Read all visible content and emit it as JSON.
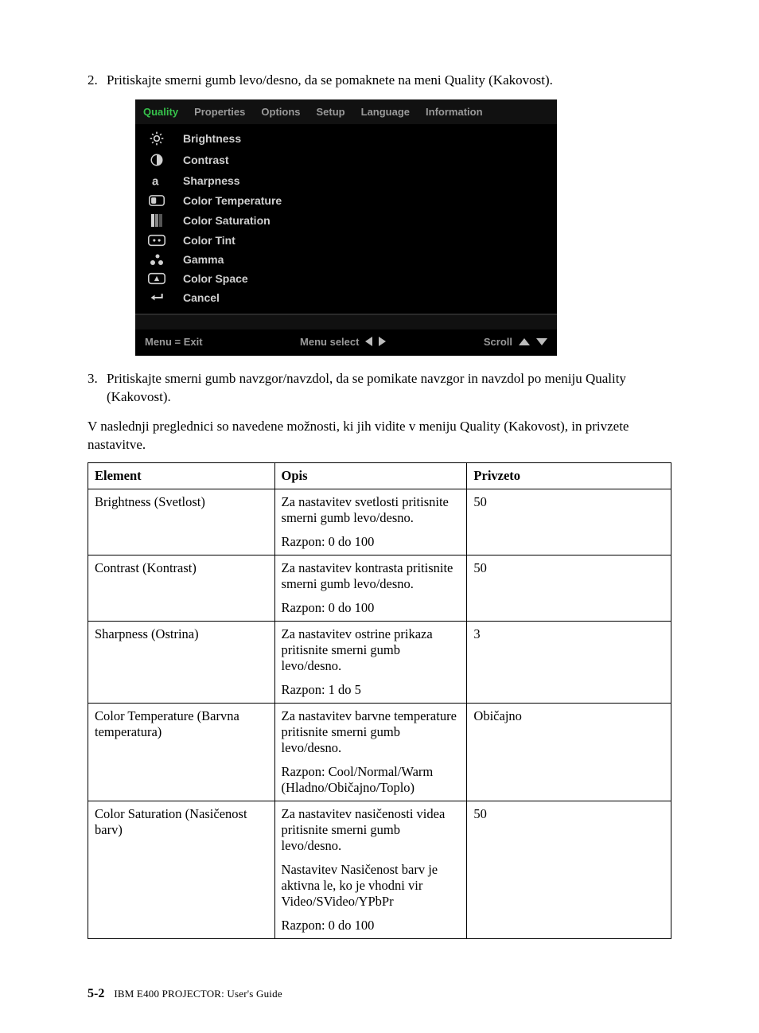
{
  "steps": {
    "s2": {
      "num": "2.",
      "text": "Pritiskajte smerni gumb levo/desno, da se pomaknete na meni Quality (Kakovost)."
    },
    "s3": {
      "num": "3.",
      "text": "Pritiskajte smerni gumb navzgor/navzdol, da se pomikate navzgor in navzdol po meniju Quality (Kakovost)."
    }
  },
  "osd": {
    "tabs": {
      "quality": "Quality",
      "properties": "Properties",
      "options": "Options",
      "setup": "Setup",
      "language": "Language",
      "information": "Information"
    },
    "items": {
      "brightness": "Brightness",
      "contrast": "Contrast",
      "sharpness": "Sharpness",
      "color_temperature": "Color Temperature",
      "color_saturation": "Color Saturation",
      "color_tint": "Color Tint",
      "gamma": "Gamma",
      "color_space": "Color Space",
      "cancel": "Cancel"
    },
    "footer": {
      "menu_exit": "Menu = Exit",
      "menu_select": "Menu select",
      "scroll": "Scroll"
    }
  },
  "intro_para": "V naslednji preglednici so navedene možnosti, ki jih vidite v meniju Quality (Kakovost), in privzete nastavitve.",
  "table": {
    "headers": {
      "element": "Element",
      "opis": "Opis",
      "privzeto": "Privzeto"
    },
    "rows": [
      {
        "element": "Brightness (Svetlost)",
        "opis1": "Za nastavitev svetlosti pritisnite smerni gumb levo/desno.",
        "opis2": "Razpon: 0 do 100",
        "privzeto": "50"
      },
      {
        "element": "Contrast (Kontrast)",
        "opis1": "Za nastavitev kontrasta pritisnite smerni gumb levo/desno.",
        "opis2": "Razpon: 0 do 100",
        "privzeto": "50"
      },
      {
        "element": "Sharpness (Ostrina)",
        "opis1": "Za nastavitev ostrine prikaza pritisnite smerni gumb levo/desno.",
        "opis2": "Razpon: 1 do 5",
        "privzeto": "3"
      },
      {
        "element": "Color Temperature (Barvna temperatura)",
        "opis1": "Za nastavitev barvne temperature pritisnite smerni gumb levo/desno.",
        "opis2": "Razpon: Cool/Normal/Warm (Hladno/Običajno/Toplo)",
        "privzeto": "Običajno"
      },
      {
        "element": "Color Saturation (Nasičenost barv)",
        "opis1": "Za nastavitev nasičenosti videa pritisnite smerni gumb levo/desno.",
        "opis2": "Nastavitev Nasičenost barv je aktivna le, ko je vhodni vir Video/SVideo/YPbPr",
        "opis3": "Razpon: 0 do 100",
        "privzeto": "50"
      }
    ]
  },
  "footer": {
    "page": "5-2",
    "book": "IBM E400 PROJECTOR: User's Guide"
  }
}
